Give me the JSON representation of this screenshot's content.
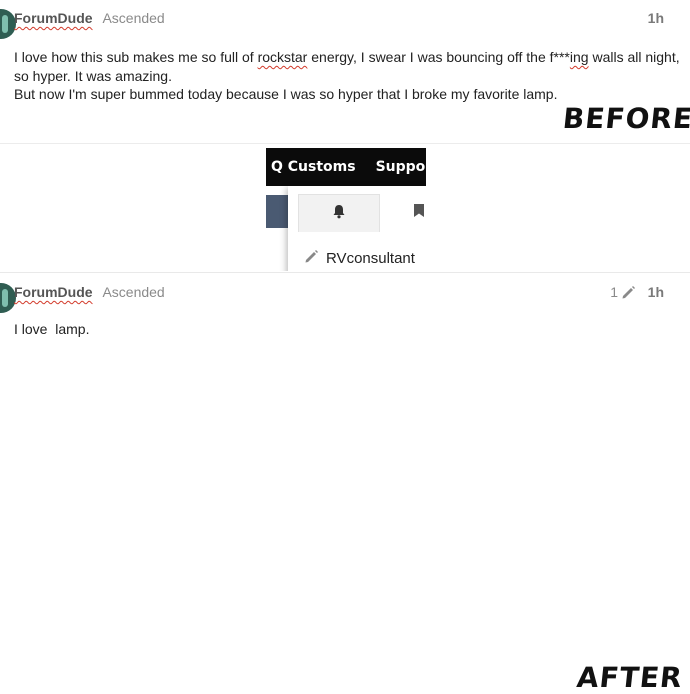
{
  "post_before": {
    "username": "ForumDude",
    "group_title": "Ascended",
    "time": "1h",
    "paragraph_1": {
      "part_1": "I love how this sub makes me so full of ",
      "word_1": "rockstar",
      "part_2": " energy, I swear I was bouncing off the f***",
      "word_2": "ing",
      "part_3": " walls all night, so hyper. It was amazing."
    },
    "paragraph_2": "But now I'm super bummed today because I was so hyper that I broke my favorite lamp.",
    "annotation": "BEFORE"
  },
  "screenshot_panel": {
    "nav_items": [
      "Q Customs",
      "Support"
    ],
    "menu_username": "RVconsultant",
    "icons": {
      "active_tab": "bell-icon",
      "second_tab": "bookmark-icon",
      "user_row": "pencil-icon"
    },
    "colors": {
      "nav_bg": "#0b0b0b",
      "band": "#4a5a72"
    }
  },
  "post_after": {
    "username": "ForumDude",
    "group_title": "Ascended",
    "edit_count": "1",
    "time": "1h",
    "body": "I love  lamp.",
    "annotation": "AFTER"
  },
  "colors": {
    "spellcheck_underline": "#d23a2a",
    "username": "#555555",
    "meta_gray": "#8a8a8a"
  }
}
